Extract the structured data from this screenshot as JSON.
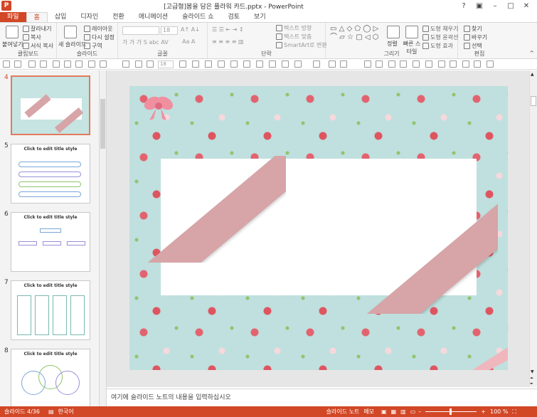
{
  "window": {
    "title": "[고급형]봄을 담은 플라워 카드.pptx - PowerPoint"
  },
  "tabs": [
    "파일",
    "홈",
    "삽입",
    "디자인",
    "전환",
    "애니메이션",
    "슬라이드 쇼",
    "검토",
    "보기"
  ],
  "ribbon": {
    "clipboard": {
      "label": "클립보드",
      "paste": "붙여넣기",
      "cut": "잘라내기",
      "copy": "복사",
      "format": "서식 복사"
    },
    "slides": {
      "label": "슬라이드",
      "new": "새 슬라이드",
      "layout": "레이아웃",
      "reset": "다시 설정",
      "section": "구역"
    },
    "font": {
      "label": "글꼴",
      "size": "18"
    },
    "paragraph": {
      "label": "단락",
      "direction": "텍스트 방향",
      "align": "텍스트 맞춤",
      "smartart": "SmartArt로 변환"
    },
    "drawing": {
      "label": "그리기",
      "arrange": "정렬",
      "quickstyle": "빠른 스타일",
      "fill": "도형 채우기",
      "outline": "도형 윤곽선",
      "effect": "도형 효과"
    },
    "editing": {
      "label": "편집",
      "find": "찾기",
      "replace": "바꾸기",
      "select": "선택"
    }
  },
  "qat": {
    "size": "18"
  },
  "slides": [
    {
      "num": "4",
      "title": ""
    },
    {
      "num": "5",
      "title": "Click to edit title style"
    },
    {
      "num": "6",
      "title": "Click to edit title style"
    },
    {
      "num": "7",
      "title": "Click to edit title style"
    },
    {
      "num": "8",
      "title": "Click to edit title style"
    }
  ],
  "notes": {
    "placeholder": "여기에 슬라이드 노트의 내용을 입력하십시오"
  },
  "status": {
    "slide": "슬라이드 4/36",
    "lang": "한국어",
    "notes": "슬라이드 노트",
    "comments": "메모",
    "zoom": "100 %"
  },
  "colors": {
    "accent": "#d24726",
    "ribbon": "#d7a4a7",
    "slide_bg": "#bfe0de"
  }
}
